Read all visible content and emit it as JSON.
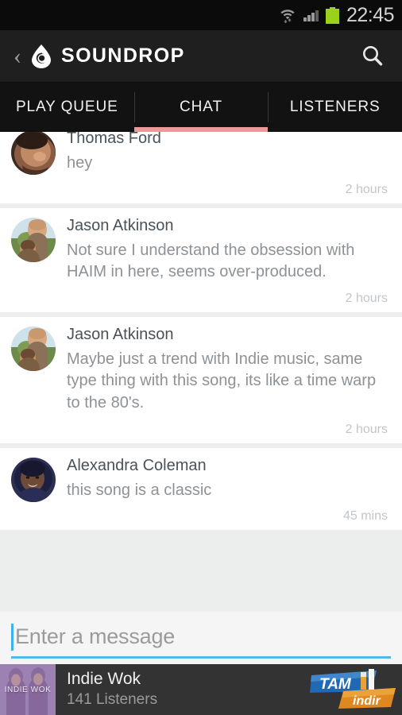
{
  "statusbar": {
    "time": "22:45",
    "icons": [
      "wifi-icon",
      "cellular-signal-icon",
      "battery-icon"
    ],
    "battery_color": "#9bd11a"
  },
  "actionbar": {
    "back_label": "‹",
    "logo_icon": "soundrop-droplet-icon",
    "brand": "SOUNDROP",
    "search_icon": "search-icon"
  },
  "tabs": {
    "items": [
      {
        "label": "PLAY QUEUE",
        "selected": false
      },
      {
        "label": "CHAT",
        "selected": true
      },
      {
        "label": "LISTENERS",
        "selected": false
      }
    ],
    "indicator_color": "#eb9a9a"
  },
  "messages": [
    {
      "author": "Thomas Ford",
      "text": "hey",
      "time": "2 hours",
      "avatar": "thomas-ford-avatar",
      "clipped": true
    },
    {
      "author": "Jason Atkinson",
      "text": "Not sure I understand the obsession with HAIM in here, seems over-produced.",
      "time": "2 hours",
      "avatar": "jason-atkinson-avatar",
      "clipped": false
    },
    {
      "author": "Jason Atkinson",
      "text": "Maybe just a trend with Indie music, same type thing with this song, its like a time warp to the 80's.",
      "time": "2 hours",
      "avatar": "jason-atkinson-avatar",
      "clipped": false
    },
    {
      "author": "Alexandra Coleman",
      "text": "this song is a classic",
      "time": "45 mins",
      "avatar": "alexandra-coleman-avatar",
      "clipped": false
    }
  ],
  "composer": {
    "value": "",
    "placeholder": "Enter a message",
    "accent_color": "#3eb0ea"
  },
  "nowplaying": {
    "album_art_label": "INDIE WOK",
    "title": "Indie Wok",
    "listeners": "141 Listeners"
  },
  "watermark": {
    "primary": "TAM",
    "secondary": "indir"
  }
}
